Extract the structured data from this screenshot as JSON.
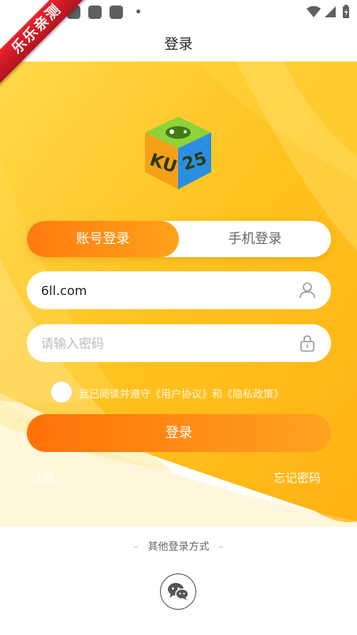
{
  "app": {
    "title": "登录",
    "ribbon": "乐乐亲测",
    "logo_text": "KU25"
  },
  "login_tabs": [
    {
      "label": "账号登录",
      "active": true
    },
    {
      "label": "手机登录",
      "active": false
    }
  ],
  "form": {
    "account_value": "6ll.com",
    "account_icon": "user-icon",
    "password_placeholder": "请输入密码",
    "password_icon": "lock-icon"
  },
  "agreement": {
    "prefix": "我已阅读并遵守",
    "user_agreement": "《用户协议》",
    "conjunction": "和",
    "privacy_policy": "《隐私政策》",
    "checked": false
  },
  "actions": {
    "login_button": "登录",
    "register_link": "注册",
    "forgot_link": "忘记密码"
  },
  "other_login": {
    "label": "其他登录方式",
    "dash": "–",
    "wechat_icon": "wechat-icon"
  },
  "colors": {
    "accent_orange": "#ff7b0f",
    "hero_yellow": "#ffc21f",
    "ribbon_red": "#d81d27"
  }
}
